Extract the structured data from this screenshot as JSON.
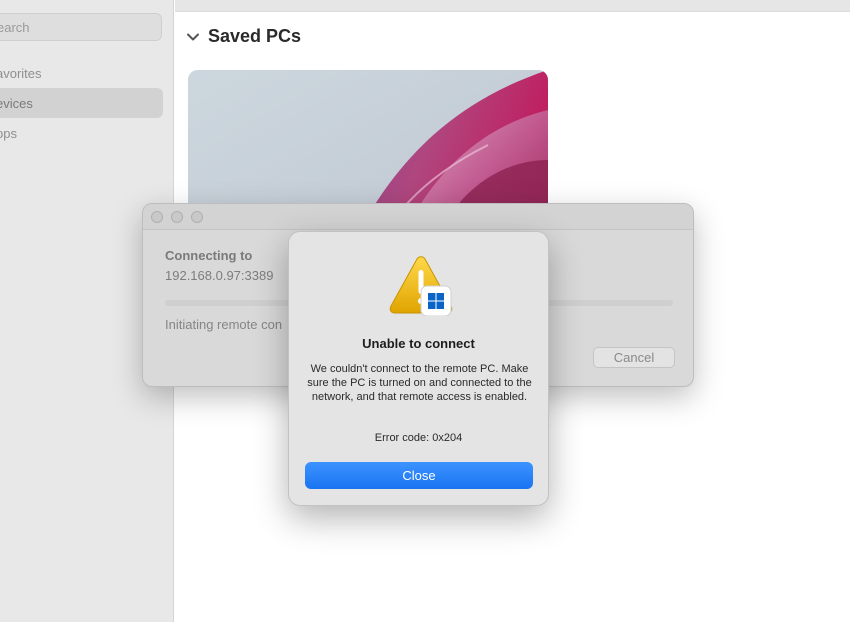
{
  "sidebar": {
    "search_placeholder": "earch",
    "items": [
      {
        "label": "avorites"
      },
      {
        "label": "evices"
      },
      {
        "label": "pps"
      }
    ]
  },
  "main": {
    "section_title": "Saved PCs"
  },
  "connecting_window": {
    "label": "Connecting to",
    "address": "192.168.0.97:3389",
    "status": "Initiating remote con",
    "cancel_label": "Cancel"
  },
  "alert": {
    "title": "Unable to connect",
    "message": "We couldn't connect to the remote PC. Make sure the PC is turned on and connected to the network, and that remote access is enabled.",
    "error_code": "Error code: 0x204",
    "close_label": "Close",
    "icon": "warning-windows-icon"
  },
  "colors": {
    "accent": "#1a74f2",
    "warning": "#f2b705",
    "windows_blue": "#0a64c8"
  }
}
